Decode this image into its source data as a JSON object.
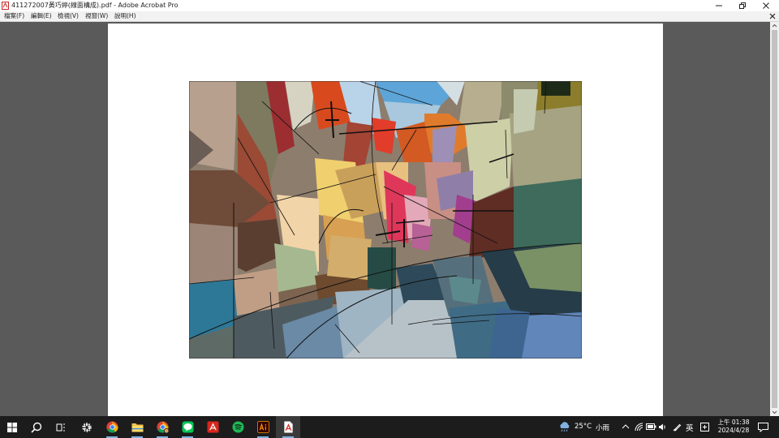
{
  "window": {
    "title": "411272007黃巧婷(線面構成).pdf - Adobe Acrobat Pro"
  },
  "menu": {
    "items": [
      "檔案(F)",
      "編輯(E)",
      "檢視(V)",
      "視窗(W)",
      "說明(H)"
    ]
  },
  "taskbar": {
    "weather": {
      "temperature": "25°C",
      "condition": "小雨"
    },
    "ime_label": "英",
    "clock": {
      "time": "上午 01:38",
      "date": "2024/4/28"
    },
    "apps": [
      "start-icon",
      "search-icon",
      "task-view-icon",
      "settings-icon",
      "chrome-icon",
      "file-explorer-icon",
      "chrome-profile-icon",
      "line-icon",
      "acrobat-icon",
      "spotify-icon",
      "illustrator-icon",
      "acrobat-pro-icon"
    ]
  },
  "colors": {
    "taskbar_bg": "#1c1c1c",
    "viewport_bg": "#5a5a5a",
    "acrobat_red": "#d7261e"
  }
}
